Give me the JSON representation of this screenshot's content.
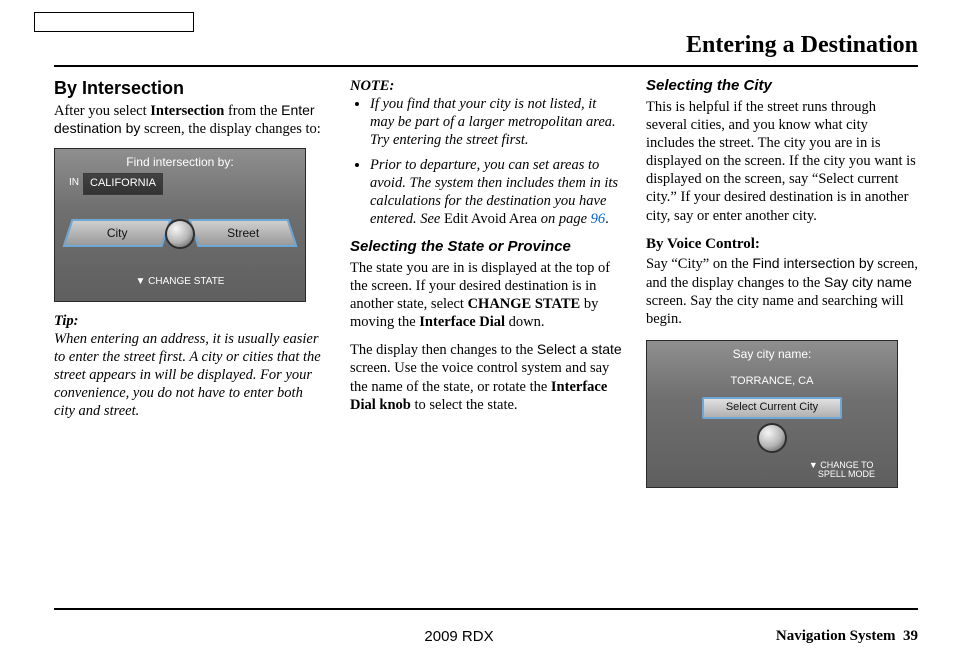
{
  "header": {
    "title": "Entering a Destination"
  },
  "col1": {
    "h2": "By Intersection",
    "intro_pre": "After you select ",
    "intro_b1": "Intersection",
    "intro_mid": " from the ",
    "intro_sans": "Enter destination by",
    "intro_post": " screen, the display changes to:",
    "tip_label": "Tip:",
    "tip_body": "When entering an address, it is usually easier to enter the street first. A city or cities that the street appears in will be displayed. For your convenience, you do not have to enter both city and street."
  },
  "screen1": {
    "title": "Find intersection by:",
    "in_label": "IN",
    "state": "CALIFORNIA",
    "city": "City",
    "street": "Street",
    "change": "▼ CHANGE STATE"
  },
  "col2": {
    "note_label": "NOTE:",
    "note1": "If you find that your city is not listed, it may be part of a larger metropolitan area. Try entering the street first.",
    "note2_pre": "Prior to departure, you can set areas to avoid. The system then includes them in its calculations for the destination you have entered. See ",
    "note2_roman": "Edit Avoid Area",
    "note2_post": " on page ",
    "note2_page": "96",
    "note2_dot": ".",
    "h3": "Selecting the State or Province",
    "p1_pre": "The state you are in is displayed at the top of the screen. If your desired destination is in another state, select ",
    "p1_b1": "CHANGE STATE",
    "p1_mid": " by moving the ",
    "p1_b2": "Interface Dial",
    "p1_post": " down.",
    "p2_pre": "The display then changes to the ",
    "p2_sans": "Select a state",
    "p2_mid": " screen. Use the voice control system and say the name of the state, or rotate the ",
    "p2_b1": "Interface Dial knob",
    "p2_post": " to select the state."
  },
  "col3": {
    "h3": "Selecting the City",
    "p1": "This is helpful if the street runs through several cities, and you know what city includes the street. The city you are in is displayed on the screen. If the city you want is displayed on the screen, say “Select current city.” If your desired destination is in another city, say or enter another city.",
    "h4": "By Voice Control:",
    "p2_pre": "Say “City” on the ",
    "p2_sans1": "Find intersection by",
    "p2_mid": " screen, and the display changes to the ",
    "p2_sans2": "Say city name",
    "p2_post": " screen. Say the city name and searching will begin."
  },
  "screen2": {
    "title": "Say city name:",
    "city_disp": "TORRANCE, CA",
    "select": "Select Current City",
    "spell1": "▼ CHANGE TO",
    "spell2": "SPELL MODE"
  },
  "footer": {
    "center": "2009  RDX",
    "right_label": "Navigation System",
    "page": "39"
  }
}
